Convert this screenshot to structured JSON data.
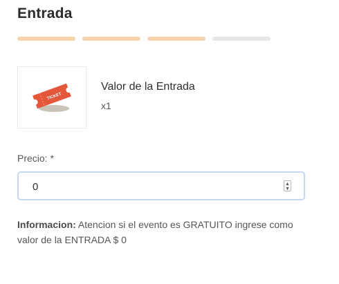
{
  "page": {
    "title": "Entrada"
  },
  "progress": {
    "total_steps": 4,
    "completed_steps": 3,
    "active_color": "#f4d5b0",
    "inactive_color": "#e6e6e6"
  },
  "ticket": {
    "image_icon": "ticket-icon",
    "image_text": "TICKET",
    "name": "Valor de la Entrada",
    "quantity": "x1"
  },
  "price": {
    "label": "Precio: *",
    "value": "0"
  },
  "info": {
    "label": "Informacion:",
    "text": "Atencion si el evento es GRATUITO ingrese como valor de la ENTRADA $ 0"
  }
}
